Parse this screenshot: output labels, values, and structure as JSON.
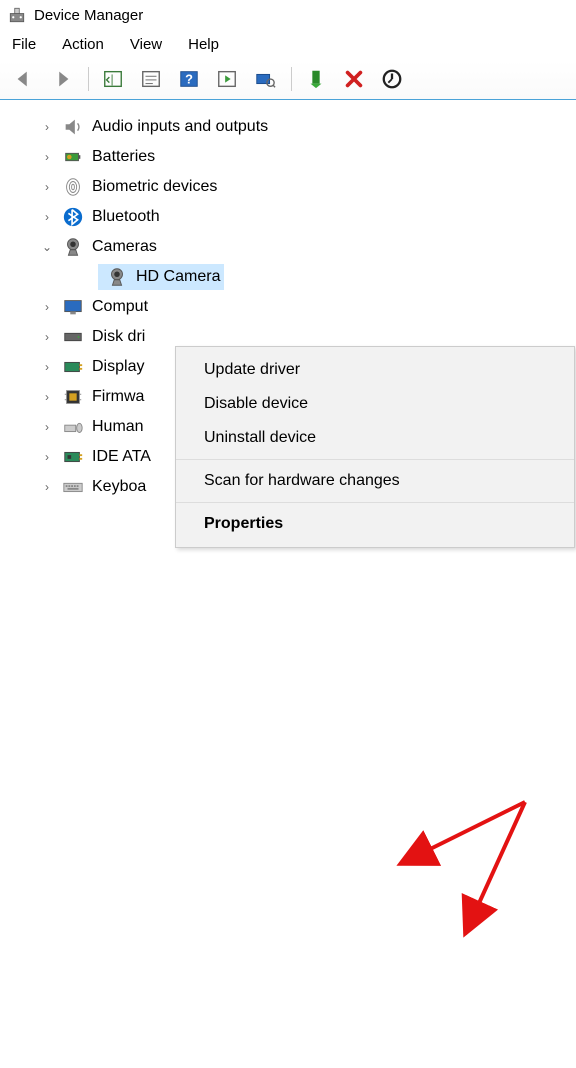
{
  "titlebar": {
    "title": "Device Manager"
  },
  "menubar": {
    "items": [
      "File",
      "Action",
      "View",
      "Help"
    ]
  },
  "tree": {
    "items": [
      {
        "expanded": false,
        "icon": "speaker",
        "label": "Audio inputs and outputs"
      },
      {
        "expanded": false,
        "icon": "battery",
        "label": "Batteries"
      },
      {
        "expanded": false,
        "icon": "fingerprint",
        "label": "Biometric devices"
      },
      {
        "expanded": false,
        "icon": "bluetooth",
        "label": "Bluetooth"
      },
      {
        "expanded": true,
        "icon": "camera",
        "label": "Cameras",
        "child": {
          "icon": "camera",
          "label": "HD Camera",
          "selected": true
        }
      },
      {
        "expanded": false,
        "icon": "monitor",
        "label": "Comput"
      },
      {
        "expanded": false,
        "icon": "disk",
        "label": "Disk dri"
      },
      {
        "expanded": false,
        "icon": "display",
        "label": "Display"
      },
      {
        "expanded": false,
        "icon": "chip",
        "label": "Firmwa"
      },
      {
        "expanded": false,
        "icon": "hid",
        "label": "Human"
      },
      {
        "expanded": false,
        "icon": "ide",
        "label": "IDE ATA"
      },
      {
        "expanded": false,
        "icon": "keyboard",
        "label": "Keyboa"
      }
    ]
  },
  "context_menu": {
    "items": [
      {
        "label": "Update driver",
        "type": "item"
      },
      {
        "label": "Disable device",
        "type": "item"
      },
      {
        "label": "Uninstall device",
        "type": "item"
      },
      {
        "type": "divider"
      },
      {
        "label": "Scan for hardware changes",
        "type": "item"
      },
      {
        "type": "divider"
      },
      {
        "label": "Properties",
        "type": "item",
        "bold": true
      }
    ]
  }
}
